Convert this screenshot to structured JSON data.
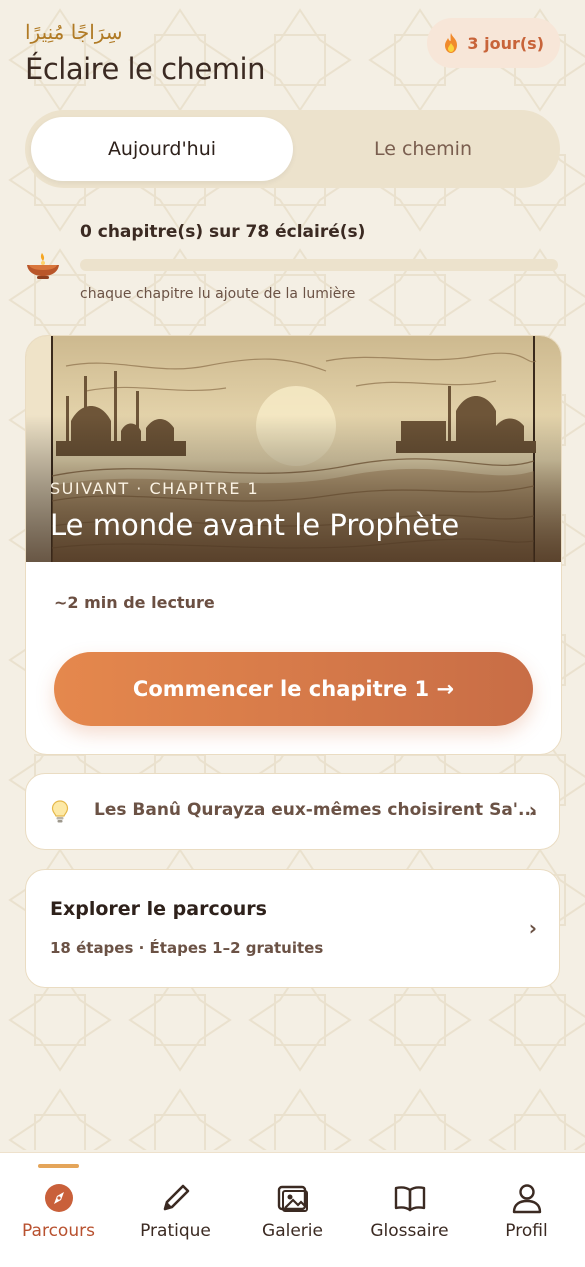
{
  "header": {
    "arabic_title": "سِرَاجًا مُنِيرًا",
    "title": "Éclaire le chemin",
    "streak_label": "3 jour(s)"
  },
  "tabs": [
    {
      "label": "Aujourd'hui",
      "active": true
    },
    {
      "label": "Le chemin",
      "active": false
    }
  ],
  "progress": {
    "title": "0 chapitre(s) sur 78 éclairé(s)",
    "subtitle": "chaque chapitre lu ajoute de la lumière",
    "value": 0,
    "total": 78
  },
  "next_chapter": {
    "kicker": "SUIVANT · CHAPITRE 1",
    "title": "Le monde avant le Prophète",
    "read_time": "~2 min de lecture",
    "button_label": "Commencer le chapitre 1 →"
  },
  "fact": {
    "text": "Les Banû Qurayza eux-mêmes choisirent Sa'...",
    "chevron": "›"
  },
  "explore": {
    "title": "Explorer le parcours",
    "subtitle": "18 étapes · Étapes 1–2 gratuites",
    "chevron": "›"
  },
  "nav": {
    "items": [
      {
        "label": "Parcours",
        "icon": "compass-icon",
        "active": true
      },
      {
        "label": "Pratique",
        "icon": "pen-icon",
        "active": false
      },
      {
        "label": "Galerie",
        "icon": "image-gallery-icon",
        "active": false
      },
      {
        "label": "Glossaire",
        "icon": "book-icon",
        "active": false
      },
      {
        "label": "Profil",
        "icon": "person-icon",
        "active": false
      }
    ]
  },
  "colors": {
    "background": "#f4efe4",
    "accent": "#d9793f",
    "accent_dark": "#b8512f",
    "text": "#3b2a22"
  }
}
